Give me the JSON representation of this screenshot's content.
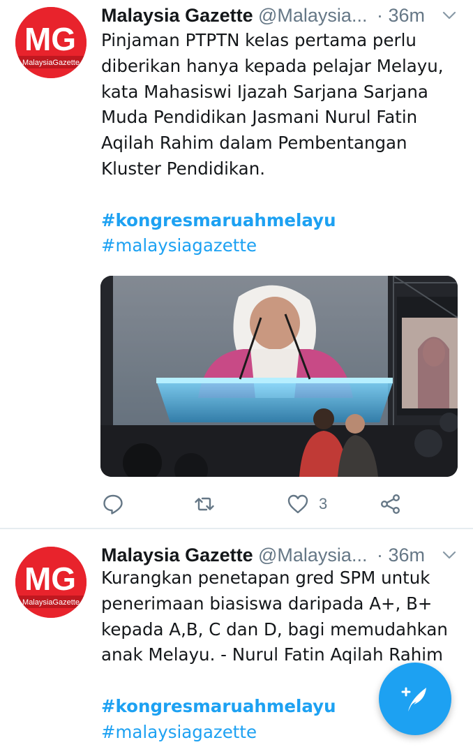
{
  "feed": {
    "tweets": [
      {
        "author_name": "Malaysia Gazette",
        "handle": "@Malaysia...",
        "time": "· 36m",
        "avatar": {
          "initials": "MG",
          "label": "MalaysiaGazette",
          "color": "#e8232c"
        },
        "text_lines": [
          "Pinjaman PTPTN kelas pertama perlu",
          "diberikan hanya kepada pelajar Melayu,",
          "kata Mahasiswi Ijazah Sarjana Sarjana",
          "Muda Pendidikan Jasmani Nurul Fatin",
          "Aqilah Rahim dalam Pembentangan",
          "Kluster Pendidikan."
        ],
        "hashtags": [
          "#kongresmaruahmelayu",
          "#malaysiagazette"
        ],
        "actions": {
          "reply_icon": "reply-icon",
          "retweet_icon": "retweet-icon",
          "like_icon": "heart-icon",
          "like_count": "3",
          "share_icon": "share-icon"
        }
      },
      {
        "author_name": "Malaysia Gazette",
        "handle": "@Malaysia...",
        "time": "· 36m",
        "avatar": {
          "initials": "MG",
          "label": "MalaysiaGazette",
          "color": "#e8232c"
        },
        "text_lines": [
          "Kurangkan penetapan gred SPM untuk",
          "penerimaan biasiswa daripada A+, B+",
          "kepada A,B, C dan D, bagi memudahkan",
          "anak Melayu. - Nurul Fatin Aqilah Rahim"
        ],
        "hashtags": [
          "#kongresmaruahmelayu",
          "#malaysiagazette"
        ]
      }
    ]
  },
  "compose_button": {
    "icon": "compose-tweet-icon",
    "color": "#1da1f2"
  },
  "colors": {
    "accent": "#1da1f2",
    "secondary_text": "#657786",
    "primary_text": "#14171a",
    "divider": "#e6ecf0"
  }
}
